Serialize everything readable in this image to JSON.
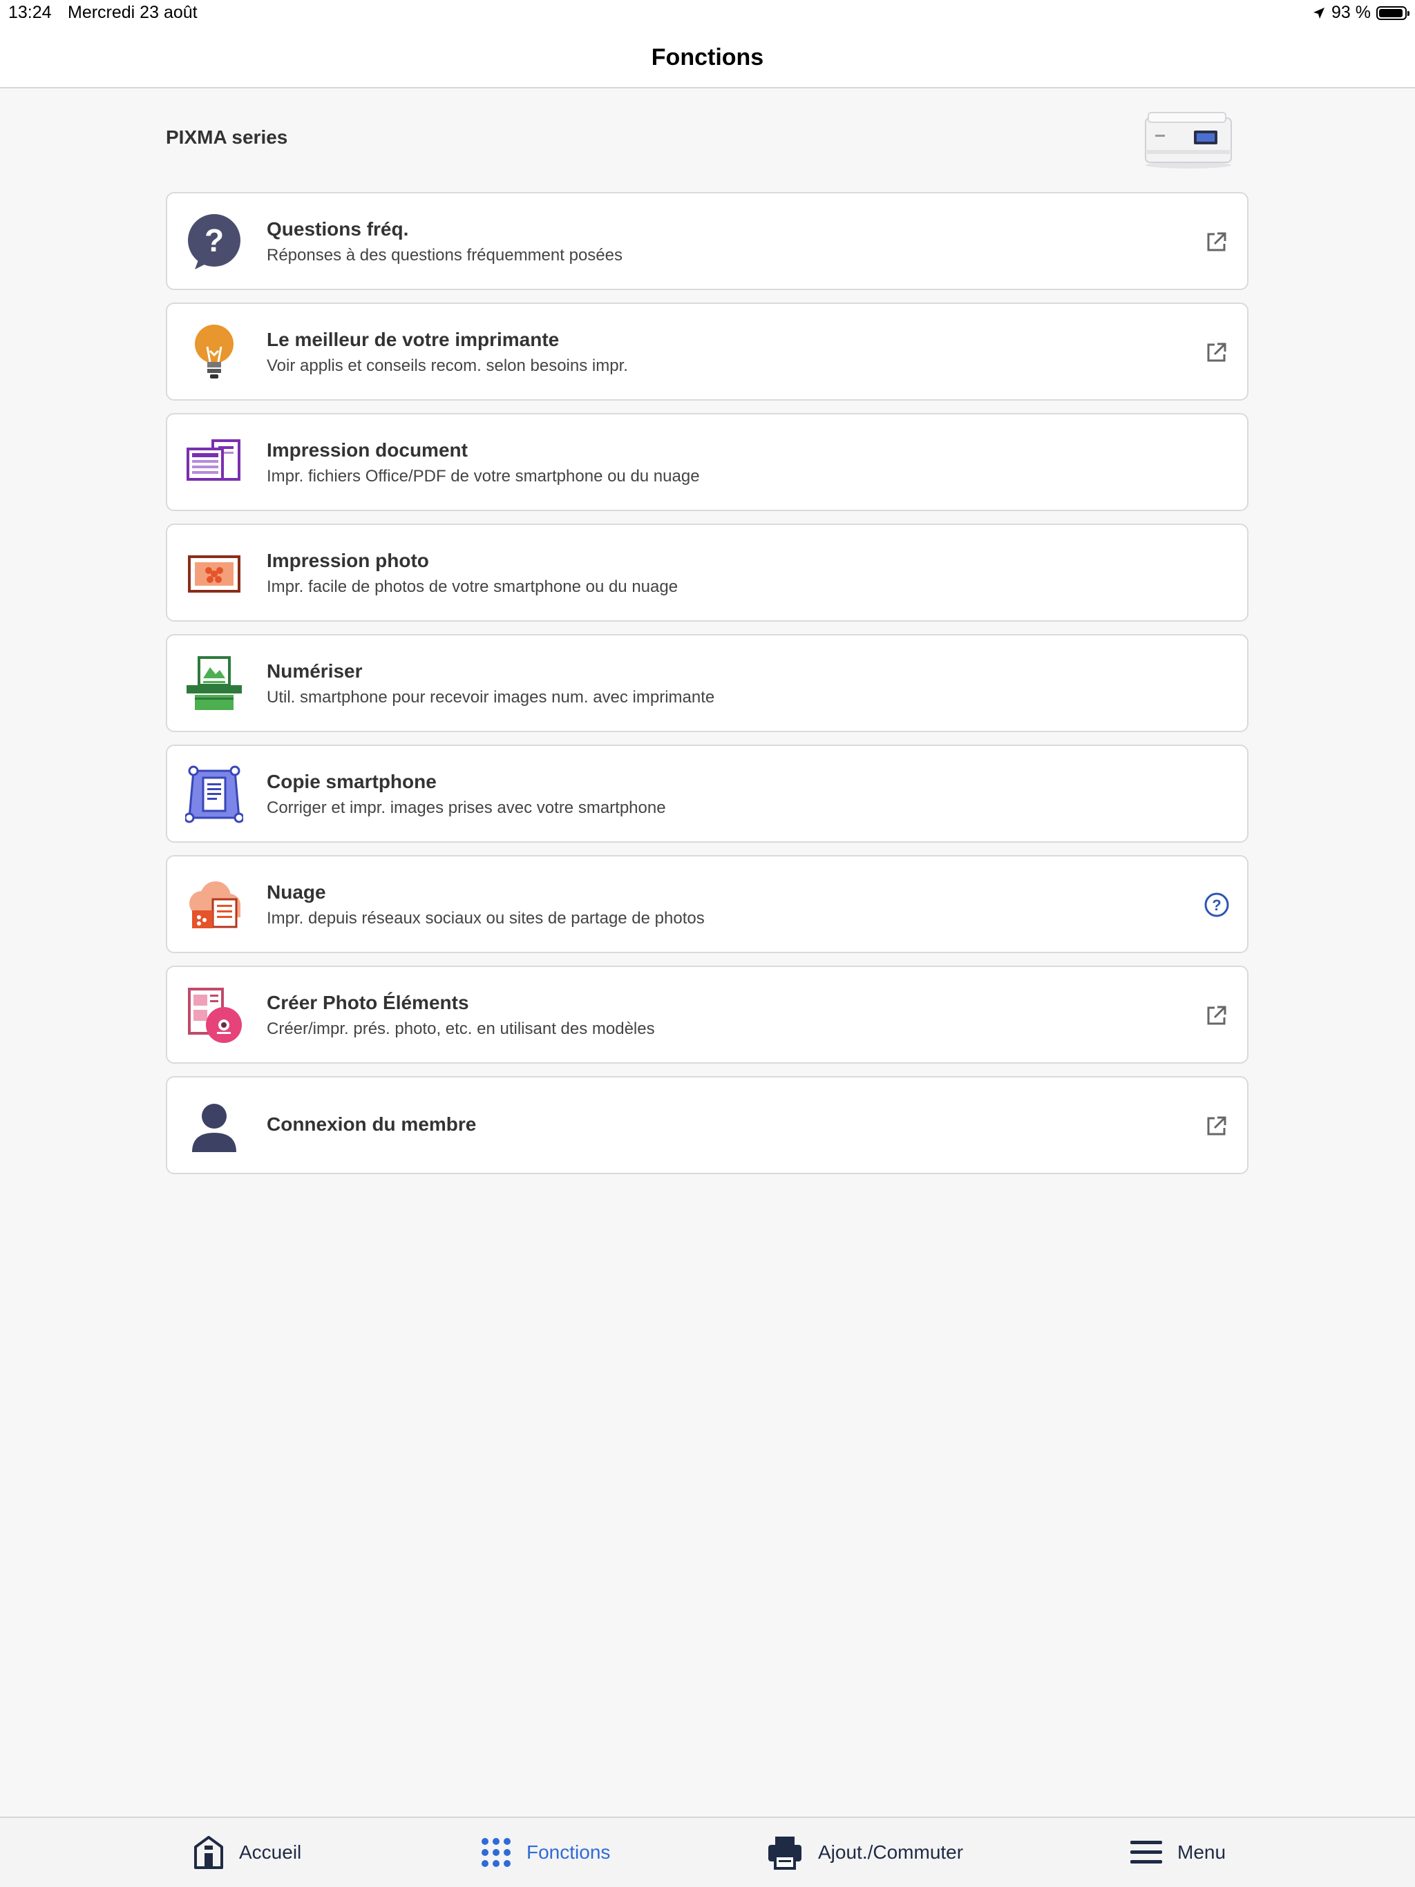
{
  "status_bar": {
    "time": "13:24",
    "date": "Mercredi 23 août",
    "battery": "93 %",
    "battery_level": 0.93
  },
  "nav": {
    "title": "Fonctions"
  },
  "printer": {
    "name": "PIXMA series"
  },
  "items": [
    {
      "title": "Questions fréq.",
      "desc": "Réponses à des questions fréquemment posées",
      "icon": "question-bubble-icon",
      "trail": "external-link-icon"
    },
    {
      "title": "Le meilleur de votre imprimante",
      "desc": "Voir applis et conseils recom. selon besoins impr.",
      "icon": "lightbulb-icon",
      "trail": "external-link-icon"
    },
    {
      "title": "Impression document",
      "desc": "Impr. fichiers Office/PDF de votre smartphone ou du nuage",
      "icon": "documents-icon",
      "trail": ""
    },
    {
      "title": "Impression photo",
      "desc": "Impr. facile de photos de votre smartphone ou du nuage",
      "icon": "photo-icon",
      "trail": ""
    },
    {
      "title": "Numériser",
      "desc": "Util. smartphone pour recevoir images num. avec imprimante",
      "icon": "scan-icon",
      "trail": ""
    },
    {
      "title": "Copie smartphone",
      "desc": "Corriger et impr. images prises avec votre smartphone",
      "icon": "copy-smartphone-icon",
      "trail": ""
    },
    {
      "title": "Nuage",
      "desc": "Impr. depuis réseaux sociaux ou sites de partage de photos",
      "icon": "cloud-icon",
      "trail": "help-circle-icon"
    },
    {
      "title": "Créer Photo Éléments",
      "desc": "Créer/impr. prés. photo, etc. en utilisant des modèles",
      "icon": "photo-elements-icon",
      "trail": "external-link-icon"
    },
    {
      "title": "Connexion du membre",
      "desc": "",
      "icon": "member-icon",
      "trail": "external-link-icon"
    }
  ],
  "tabs": [
    {
      "label": "Accueil",
      "icon": "home-icon",
      "active": false
    },
    {
      "label": "Fonctions",
      "icon": "grid-dots-icon",
      "active": true
    },
    {
      "label": "Ajout./Commuter",
      "icon": "printer-icon",
      "active": false
    },
    {
      "label": "Menu",
      "icon": "hamburger-icon",
      "active": false
    }
  ],
  "colors": {
    "accent": "#2f6bd6",
    "icon_dark": "#4a4d6e",
    "background": "#f7f7f8"
  }
}
